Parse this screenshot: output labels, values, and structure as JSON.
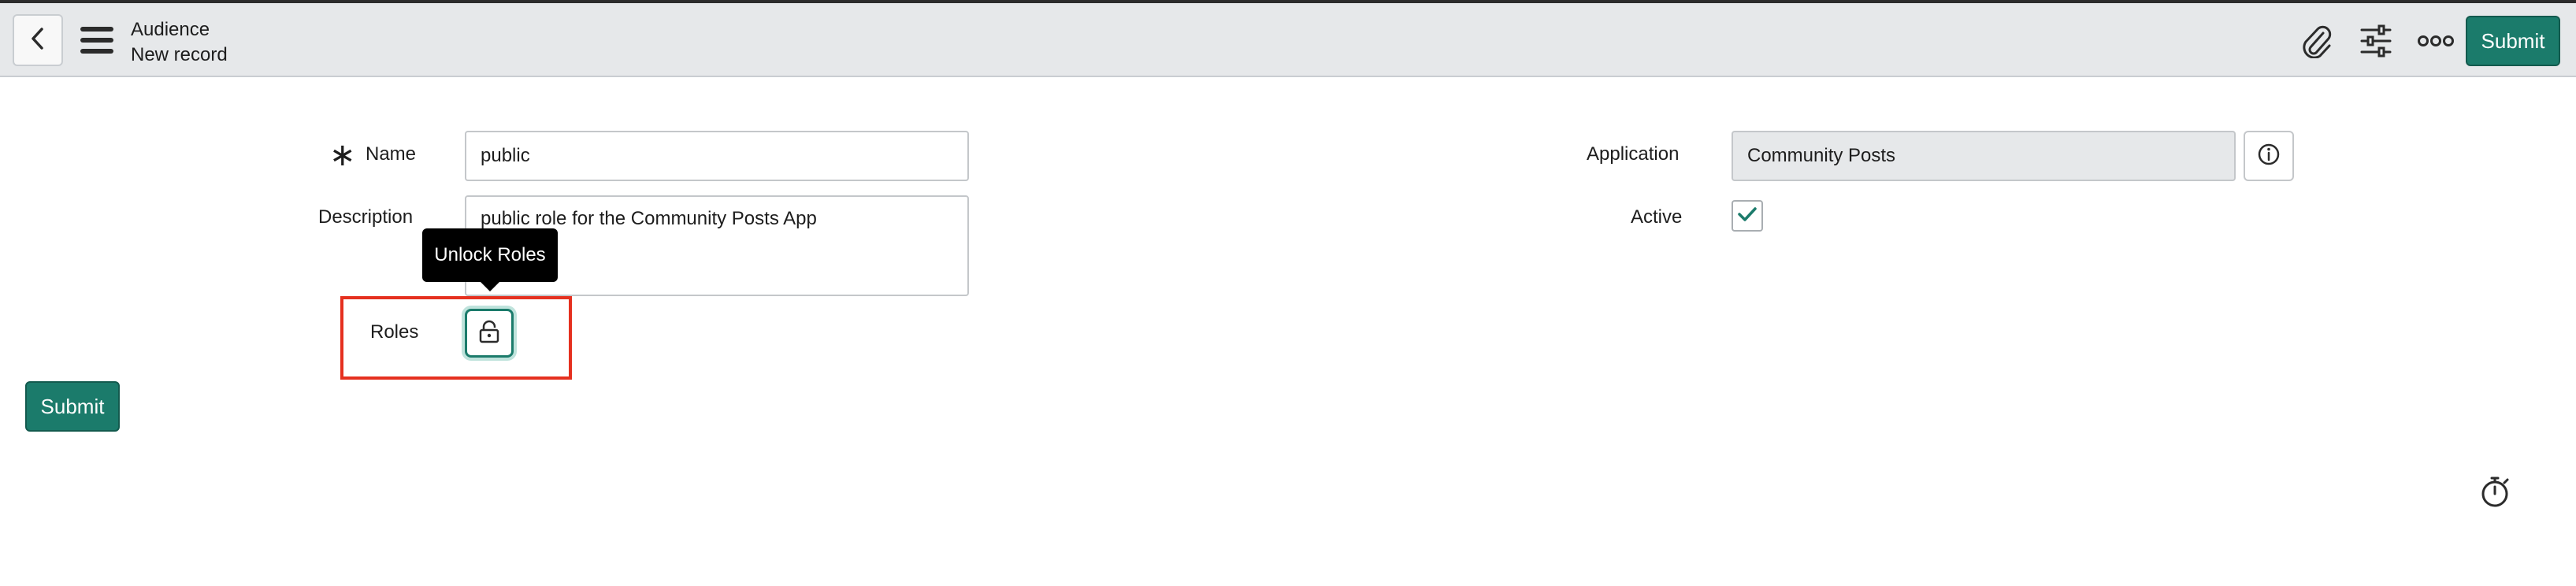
{
  "header": {
    "title": "Audience",
    "subtitle": "New record",
    "submit_label": "Submit"
  },
  "icons": {
    "back": "chevron-left",
    "menu": "hamburger",
    "attachment": "paperclip",
    "personalize": "sliders",
    "more": "ellipsis",
    "info": "info-circle",
    "lock": "lock",
    "timer": "stopwatch"
  },
  "form": {
    "name": {
      "label": "Name",
      "value": "public",
      "required": true
    },
    "description": {
      "label": "Description",
      "value": "public role for the Community Posts App"
    },
    "roles": {
      "label": "Roles",
      "tooltip": "Unlock Roles"
    },
    "application": {
      "label": "Application",
      "value": "Community Posts"
    },
    "active": {
      "label": "Active",
      "checked": true
    },
    "submit_label": "Submit"
  },
  "colors": {
    "accent": "#1b7b6b",
    "highlight": "#e5301f",
    "header_bg": "#e6e8ea"
  }
}
